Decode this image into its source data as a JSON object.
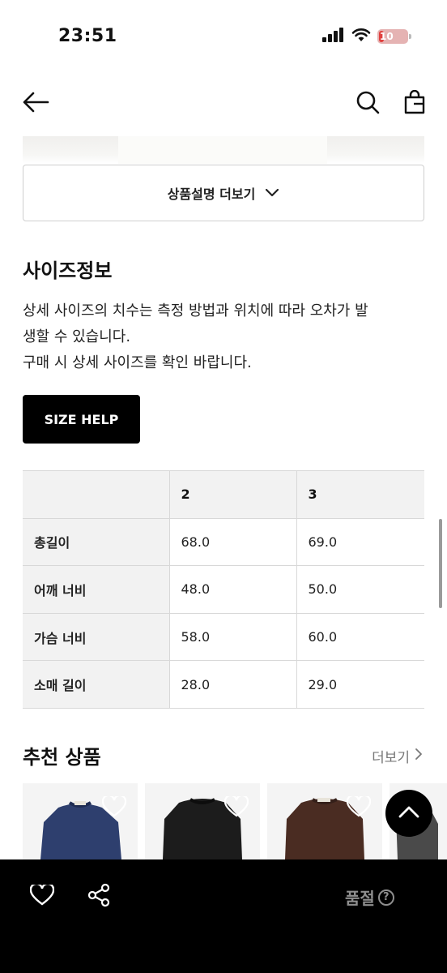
{
  "status_bar": {
    "time": "23:51",
    "battery": "10"
  },
  "top_nav": {
    "icons": [
      "back-arrow-icon",
      "search-icon",
      "shopping-bag-icon"
    ]
  },
  "product_description": {
    "more_label": "상품설명 더보기"
  },
  "size_info": {
    "title": "사이즈정보",
    "desc_line1": "상세 사이즈의 치수는 측정 방법과 위치에 따라 오차가 발",
    "desc_line2": "생할 수 있습니다.",
    "desc_line3": "구매 시 상세 사이즈를 확인 바랍니다.",
    "help_button": "SIZE HELP",
    "table": {
      "headers": [
        "",
        "2",
        "3"
      ],
      "rows": [
        {
          "label": "총길이",
          "values": [
            "68.0",
            "69.0"
          ]
        },
        {
          "label": "어깨 너비",
          "values": [
            "48.0",
            "50.0"
          ]
        },
        {
          "label": "가슴 너비",
          "values": [
            "58.0",
            "60.0"
          ]
        },
        {
          "label": "소매 길이",
          "values": [
            "28.0",
            "29.0"
          ]
        }
      ]
    }
  },
  "recommended": {
    "title": "추천 상품",
    "more_label": "더보기",
    "products": [
      {
        "color": "navy sweater"
      },
      {
        "color": "black sweater"
      },
      {
        "color": "brown sweater"
      },
      {
        "color": "grey vest"
      }
    ]
  },
  "bottom_bar": {
    "soldout_label": "품절",
    "help_glyph": "?"
  },
  "colors": {
    "accent": "#000000",
    "border": "#d8d8d8",
    "header_bg": "#f2f2f2",
    "muted_text": "#8e8e8e"
  }
}
